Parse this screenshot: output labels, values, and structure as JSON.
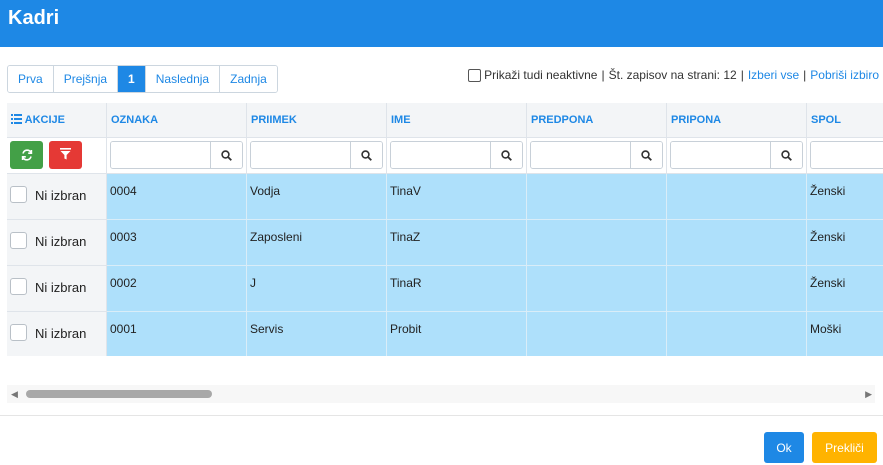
{
  "window": {
    "title": "Kadri"
  },
  "pager": {
    "first": "Prva",
    "prev": "Prejšnja",
    "current": "1",
    "next": "Naslednja",
    "last": "Zadnja"
  },
  "options": {
    "show_inactive": "Prikaži tudi neaktivne",
    "separator": "|",
    "records_per_page": "Št. zapisov na strani: 12",
    "select_all": "Izberi vse",
    "clear_selection": "Pobriši izbiro"
  },
  "table": {
    "columns": {
      "actions": "AKCIJE",
      "oznaka": "OZNAKA",
      "priimek": "PRIIMEK",
      "ime": "IME",
      "predpona": "PREDPONA",
      "pripona": "PRIPONA",
      "spol": "SPOL"
    },
    "rows": [
      {
        "select_label": "Ni izbran",
        "oznaka": "0004",
        "priimek": "Vodja",
        "ime": "TinaV",
        "predpona": "",
        "pripona": "",
        "spol": "Ženski"
      },
      {
        "select_label": "Ni izbran",
        "oznaka": "0003",
        "priimek": "Zaposleni",
        "ime": "TinaZ",
        "predpona": "",
        "pripona": "",
        "spol": "Ženski"
      },
      {
        "select_label": "Ni izbran",
        "oznaka": "0002",
        "priimek": "J",
        "ime": "TinaR",
        "predpona": "",
        "pripona": "",
        "spol": "Ženski"
      },
      {
        "select_label": "Ni izbran",
        "oznaka": "0001",
        "priimek": "Servis",
        "ime": "Probit",
        "predpona": "",
        "pripona": "",
        "spol": "Moški"
      }
    ]
  },
  "buttons": {
    "ok": "Ok",
    "cancel": "Prekliči"
  },
  "icons": {
    "list": "list-icon",
    "refresh": "refresh-icon",
    "filter": "filter-icon",
    "search": "search-icon",
    "scroll_left": "arrow-left-icon",
    "scroll_right": "arrow-right-icon"
  },
  "colors": {
    "primary": "#1e88e5",
    "selected_row": "#aee0fb",
    "refresh": "#43a047",
    "filter": "#e53935",
    "cancel": "#ffb300"
  }
}
